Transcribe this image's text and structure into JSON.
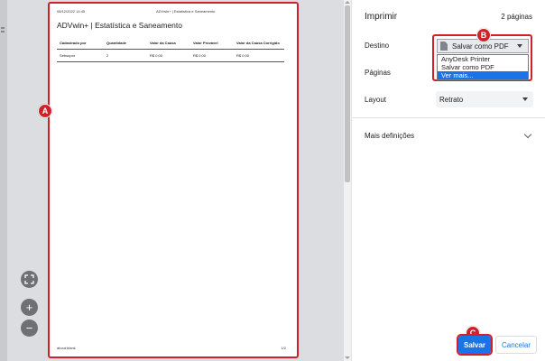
{
  "preview": {
    "header_date": "08/12/2022 14:45",
    "header_title": "ADVwin+ | Estatística e Saneamento",
    "doc_title": "ADVwin+ | Estatística e Saneamento",
    "table": {
      "columns": [
        "Cadastrado por",
        "Quantidade",
        "Valor da Causa",
        "Valor Provável",
        "Valor da Causa Corrigido"
      ],
      "rows": [
        [
          "Sebsupor",
          "2",
          "R$ 0,00",
          "R$ 0,00",
          "R$ 0,00"
        ]
      ]
    },
    "footer_left": "about:blank",
    "footer_right": "1/2",
    "zoom_fit_icon": "fit-to-page-icon",
    "zoom_in_label": "+",
    "zoom_out_label": "−"
  },
  "badges": {
    "a": "A",
    "b": "B",
    "c": "C"
  },
  "panel": {
    "title": "Imprimir",
    "page_count": "2 páginas",
    "destination_label": "Destino",
    "destination_value": "Salvar como PDF",
    "destination_options": [
      "AnyDesk Printer",
      "Salvar como PDF",
      "Ver mais..."
    ],
    "pages_label": "Páginas",
    "layout_label": "Layout",
    "layout_value": "Retrato",
    "more_settings": "Mais definições",
    "save_button": "Salvar",
    "cancel_button": "Cancelar"
  },
  "colors": {
    "accent": "#1a73e8",
    "highlight": "#d0212b"
  }
}
